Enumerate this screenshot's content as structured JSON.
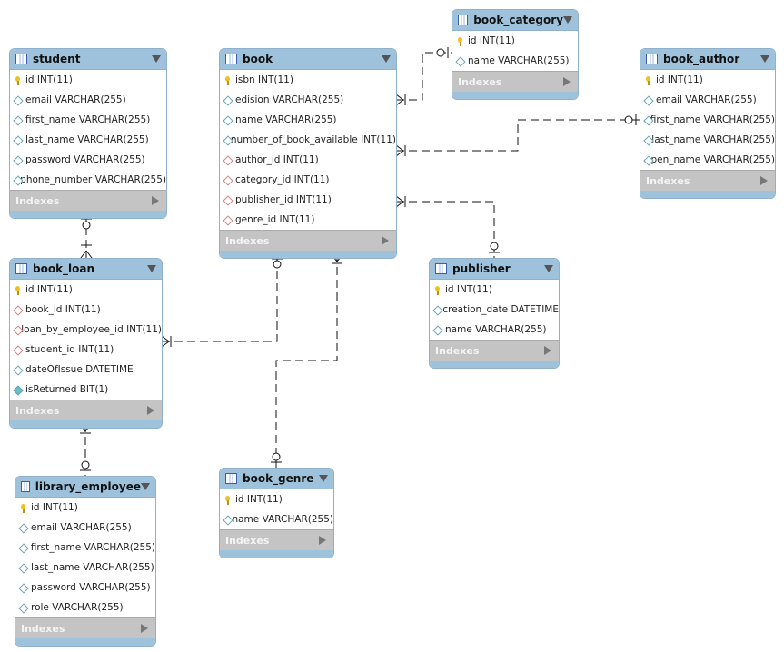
{
  "indexes_label": "Indexes",
  "tables": [
    {
      "id": "student",
      "name": "student",
      "cols": [
        [
          "id INT(11)",
          "key"
        ],
        [
          "email VARCHAR(255)",
          "col"
        ],
        [
          "first_name VARCHAR(255)",
          "col"
        ],
        [
          "last_name VARCHAR(255)",
          "col"
        ],
        [
          "password VARCHAR(255)",
          "col"
        ],
        [
          "phone_number VARCHAR(255)",
          "col"
        ]
      ]
    },
    {
      "id": "book",
      "name": "book",
      "cols": [
        [
          "isbn INT(11)",
          "key"
        ],
        [
          "edision VARCHAR(255)",
          "col"
        ],
        [
          "name VARCHAR(255)",
          "col"
        ],
        [
          "number_of_book_available INT(11)",
          "col"
        ],
        [
          "author_id INT(11)",
          "fk"
        ],
        [
          "category_id INT(11)",
          "fk"
        ],
        [
          "publisher_id INT(11)",
          "fk"
        ],
        [
          "genre_id INT(11)",
          "fk"
        ]
      ]
    },
    {
      "id": "book_category",
      "name": "book_category",
      "cols": [
        [
          "id INT(11)",
          "key"
        ],
        [
          "name VARCHAR(255)",
          "col"
        ]
      ]
    },
    {
      "id": "book_author",
      "name": "book_author",
      "cols": [
        [
          "id INT(11)",
          "key"
        ],
        [
          "email VARCHAR(255)",
          "col"
        ],
        [
          "first_name VARCHAR(255)",
          "col"
        ],
        [
          "last_name VARCHAR(255)",
          "col"
        ],
        [
          "pen_name VARCHAR(255)",
          "col"
        ]
      ]
    },
    {
      "id": "book_loan",
      "name": "book_loan",
      "cols": [
        [
          "id INT(11)",
          "key"
        ],
        [
          "book_id INT(11)",
          "fk"
        ],
        [
          "loan_by_employee_id INT(11)",
          "fk"
        ],
        [
          "student_id INT(11)",
          "fk"
        ],
        [
          "dateOfIssue DATETIME",
          "col"
        ],
        [
          "isReturned BIT(1)",
          "nn"
        ]
      ]
    },
    {
      "id": "publisher",
      "name": "publisher",
      "cols": [
        [
          "id INT(11)",
          "key"
        ],
        [
          "creation_date DATETIME",
          "col"
        ],
        [
          "name VARCHAR(255)",
          "col"
        ]
      ]
    },
    {
      "id": "library_employee",
      "name": "library_employee",
      "cols": [
        [
          "id INT(11)",
          "key"
        ],
        [
          "email VARCHAR(255)",
          "col"
        ],
        [
          "first_name VARCHAR(255)",
          "col"
        ],
        [
          "last_name VARCHAR(255)",
          "col"
        ],
        [
          "password VARCHAR(255)",
          "col"
        ],
        [
          "role VARCHAR(255)",
          "col"
        ]
      ]
    },
    {
      "id": "book_genre",
      "name": "book_genre",
      "cols": [
        [
          "id INT(11)",
          "key"
        ],
        [
          "name VARCHAR(255)",
          "col"
        ]
      ]
    }
  ],
  "relationships": [
    {
      "from": "student",
      "to": "book_loan"
    },
    {
      "from": "book_category",
      "to": "book"
    },
    {
      "from": "book_author",
      "to": "book"
    },
    {
      "from": "publisher",
      "to": "book"
    },
    {
      "from": "book",
      "to": "book_loan"
    },
    {
      "from": "book_genre",
      "to": "book"
    },
    {
      "from": "library_employee",
      "to": "book_loan"
    }
  ]
}
